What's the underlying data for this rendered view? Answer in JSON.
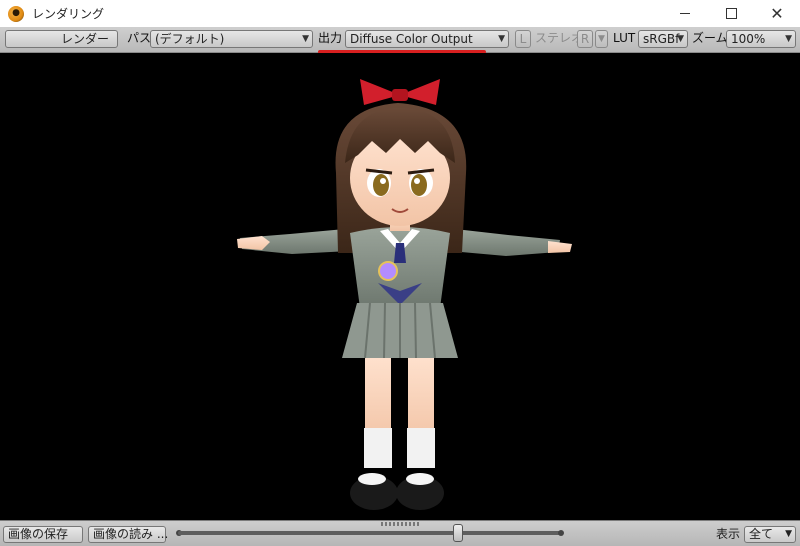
{
  "window": {
    "title": "レンダリング",
    "app_icon": "renderer-app-icon",
    "controls": {
      "minimize": "minimize-icon",
      "maximize": "maximize-icon",
      "close": "close-icon"
    }
  },
  "toolbar": {
    "renderer_label": "レンダー",
    "pass_label": "パス",
    "pass_value": "(デフォルト)",
    "output_label": "出力",
    "output_value": "Diffuse Color Output",
    "left_eye_button": "L",
    "stereo_label": "ステレオ",
    "right_eye_button": "R",
    "lut_label": "LUT",
    "lut_value": "sRGBf",
    "zoom_label": "ズーム",
    "zoom_value": "100%"
  },
  "bottom": {
    "save_image": "画像の保存",
    "load_image": "画像の読み ...",
    "display_label": "表示",
    "display_value": "全て"
  },
  "colors": {
    "highlight_underline": "#d81f1f",
    "viewport_background": "#000000"
  }
}
